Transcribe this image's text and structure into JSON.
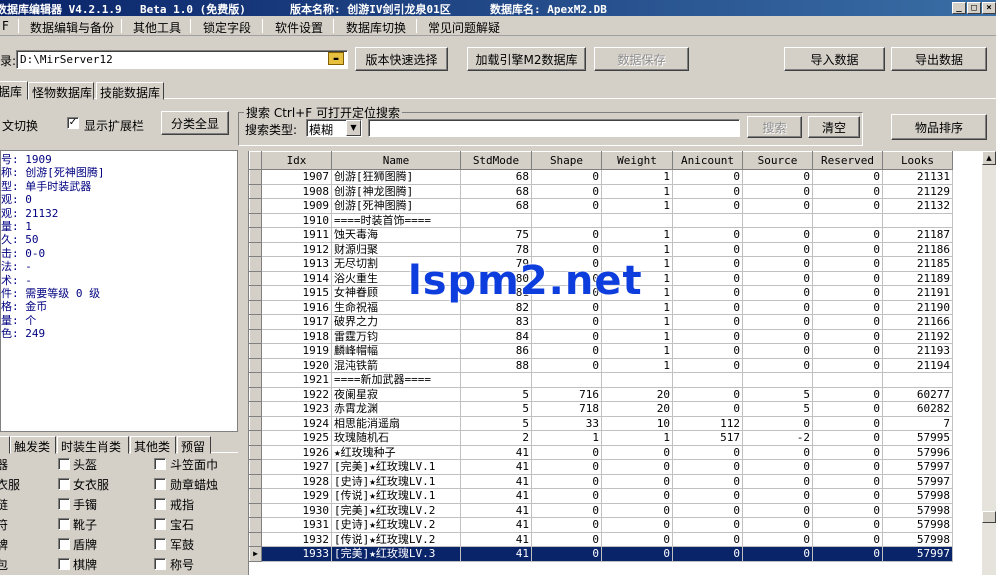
{
  "titlebar": {
    "app": "数据库编辑器 V4.2.1.9",
    "edition": "Beta 1.0 (免费版)",
    "version": "版本名称: 创游IV剑引龙泉01区",
    "db": "数据库名: ApexM2.DB"
  },
  "menu": [
    "数据编辑与备份",
    "其他工具",
    "锁定字段",
    "软件设置",
    "数据库切换",
    "常见问题解疑"
  ],
  "menu_first": "F",
  "toolbar": {
    "path_label": "录:",
    "path_value": "D:\\MirServer12",
    "quick_select": "版本快速选择",
    "load_engine": "加载引擎M2数据库",
    "save_data": "数据保存",
    "import": "导入数据",
    "export": "导出数据"
  },
  "db_tabs": [
    "据库",
    "怪物数据库",
    "技能数据库"
  ],
  "filter": {
    "switch_label": "文切换",
    "show_ext": "显示扩展栏",
    "show_ext_checked": true,
    "all_button": "分类全显",
    "search_header": "搜索  Ctrl+F 可打开定位搜索",
    "search_type_label": "搜索类型:",
    "search_type_value": "模糊",
    "search_button": "搜索",
    "clear_button": "清空",
    "sort_button": "物品排序"
  },
  "info_lines": [
    "号: 1909",
    "称: 创游[死神图腾]",
    "型: 单手时装武器",
    "观: 0",
    "观: 21132",
    "量: 1",
    "久: 50",
    "击: 0-0",
    "法: -",
    "术: -",
    "件: 需要等级 0 级",
    "格: 金币",
    "量: 个",
    "色: 249"
  ],
  "category_tabs": [
    "触发类",
    "时装生肖类",
    "其他类",
    "预留"
  ],
  "categories": [
    [
      "器",
      "头盔",
      "斗笠面巾"
    ],
    [
      "衣服",
      "女衣服",
      "勋章蜡烛"
    ],
    [
      "链",
      "手镯",
      "戒指"
    ],
    [
      "符",
      "靴子",
      "宝石"
    ],
    [
      "牌",
      "盾牌",
      "军鼓"
    ],
    [
      "包",
      "棋牌",
      "称号"
    ]
  ],
  "table": {
    "columns": [
      "Idx",
      "Name",
      "StdMode",
      "Shape",
      "Weight",
      "Anicount",
      "Source",
      "Reserved",
      "Looks"
    ],
    "selected_index": 26,
    "rows": [
      [
        "1907",
        "创游[狂狮图腾]",
        "68",
        "0",
        "1",
        "0",
        "0",
        "0",
        "21131"
      ],
      [
        "1908",
        "创游[神龙图腾]",
        "68",
        "0",
        "1",
        "0",
        "0",
        "0",
        "21129"
      ],
      [
        "1909",
        "创游[死神图腾]",
        "68",
        "0",
        "1",
        "0",
        "0",
        "0",
        "21132"
      ],
      [
        "1910",
        "====时装首饰====",
        "",
        "",
        "",
        "",
        "",
        "",
        ""
      ],
      [
        "1911",
        "蚀天毒海",
        "75",
        "0",
        "1",
        "0",
        "0",
        "0",
        "21187"
      ],
      [
        "1912",
        "财源归聚",
        "78",
        "0",
        "1",
        "0",
        "0",
        "0",
        "21186"
      ],
      [
        "1913",
        "无尽切割",
        "79",
        "0",
        "1",
        "0",
        "0",
        "0",
        "21185"
      ],
      [
        "1914",
        "浴火重生",
        "80",
        "0",
        "1",
        "0",
        "0",
        "0",
        "21189"
      ],
      [
        "1915",
        "女神眷顾",
        "81",
        "0",
        "1",
        "0",
        "0",
        "0",
        "21191"
      ],
      [
        "1916",
        "生命祝福",
        "82",
        "0",
        "1",
        "0",
        "0",
        "0",
        "21190"
      ],
      [
        "1917",
        "破界之力",
        "83",
        "0",
        "1",
        "0",
        "0",
        "0",
        "21166"
      ],
      [
        "1918",
        "雷霆万钧",
        "84",
        "0",
        "1",
        "0",
        "0",
        "0",
        "21192"
      ],
      [
        "1919",
        "麟峰帽幅",
        "86",
        "0",
        "1",
        "0",
        "0",
        "0",
        "21193"
      ],
      [
        "1920",
        "混沌铁箭",
        "88",
        "0",
        "1",
        "0",
        "0",
        "0",
        "21194"
      ],
      [
        "1921",
        "====新加武器====",
        "",
        "",
        "",
        "",
        "",
        "",
        ""
      ],
      [
        "1922",
        "夜阑星寂",
        "5",
        "716",
        "20",
        "0",
        "5",
        "0",
        "60277"
      ],
      [
        "1923",
        "赤霄龙渊",
        "5",
        "718",
        "20",
        "0",
        "5",
        "0",
        "60282"
      ],
      [
        "1924",
        "相思能消遥扇",
        "5",
        "33",
        "10",
        "112",
        "0",
        "0",
        "7"
      ],
      [
        "1925",
        "玫瑰随机石",
        "2",
        "1",
        "1",
        "517",
        "-2",
        "0",
        "57995"
      ],
      [
        "1926",
        "★红玫瑰种子",
        "41",
        "0",
        "0",
        "0",
        "0",
        "0",
        "57996"
      ],
      [
        "1927",
        "[完美]★红玫瑰LV.1",
        "41",
        "0",
        "0",
        "0",
        "0",
        "0",
        "57997"
      ],
      [
        "1928",
        "[史诗]★红玫瑰LV.1",
        "41",
        "0",
        "0",
        "0",
        "0",
        "0",
        "57997"
      ],
      [
        "1929",
        "[传说]★红玫瑰LV.1",
        "41",
        "0",
        "0",
        "0",
        "0",
        "0",
        "57998"
      ],
      [
        "1930",
        "[完美]★红玫瑰LV.2",
        "41",
        "0",
        "0",
        "0",
        "0",
        "0",
        "57998"
      ],
      [
        "1931",
        "[史诗]★红玫瑰LV.2",
        "41",
        "0",
        "0",
        "0",
        "0",
        "0",
        "57998"
      ],
      [
        "1932",
        "[传说]★红玫瑰LV.2",
        "41",
        "0",
        "0",
        "0",
        "0",
        "0",
        "57998"
      ],
      [
        "1933",
        "[完美]★红玫瑰LV.3",
        "41",
        "0",
        "0",
        "0",
        "0",
        "0",
        "57997"
      ]
    ]
  },
  "watermark": "lspm2.net"
}
